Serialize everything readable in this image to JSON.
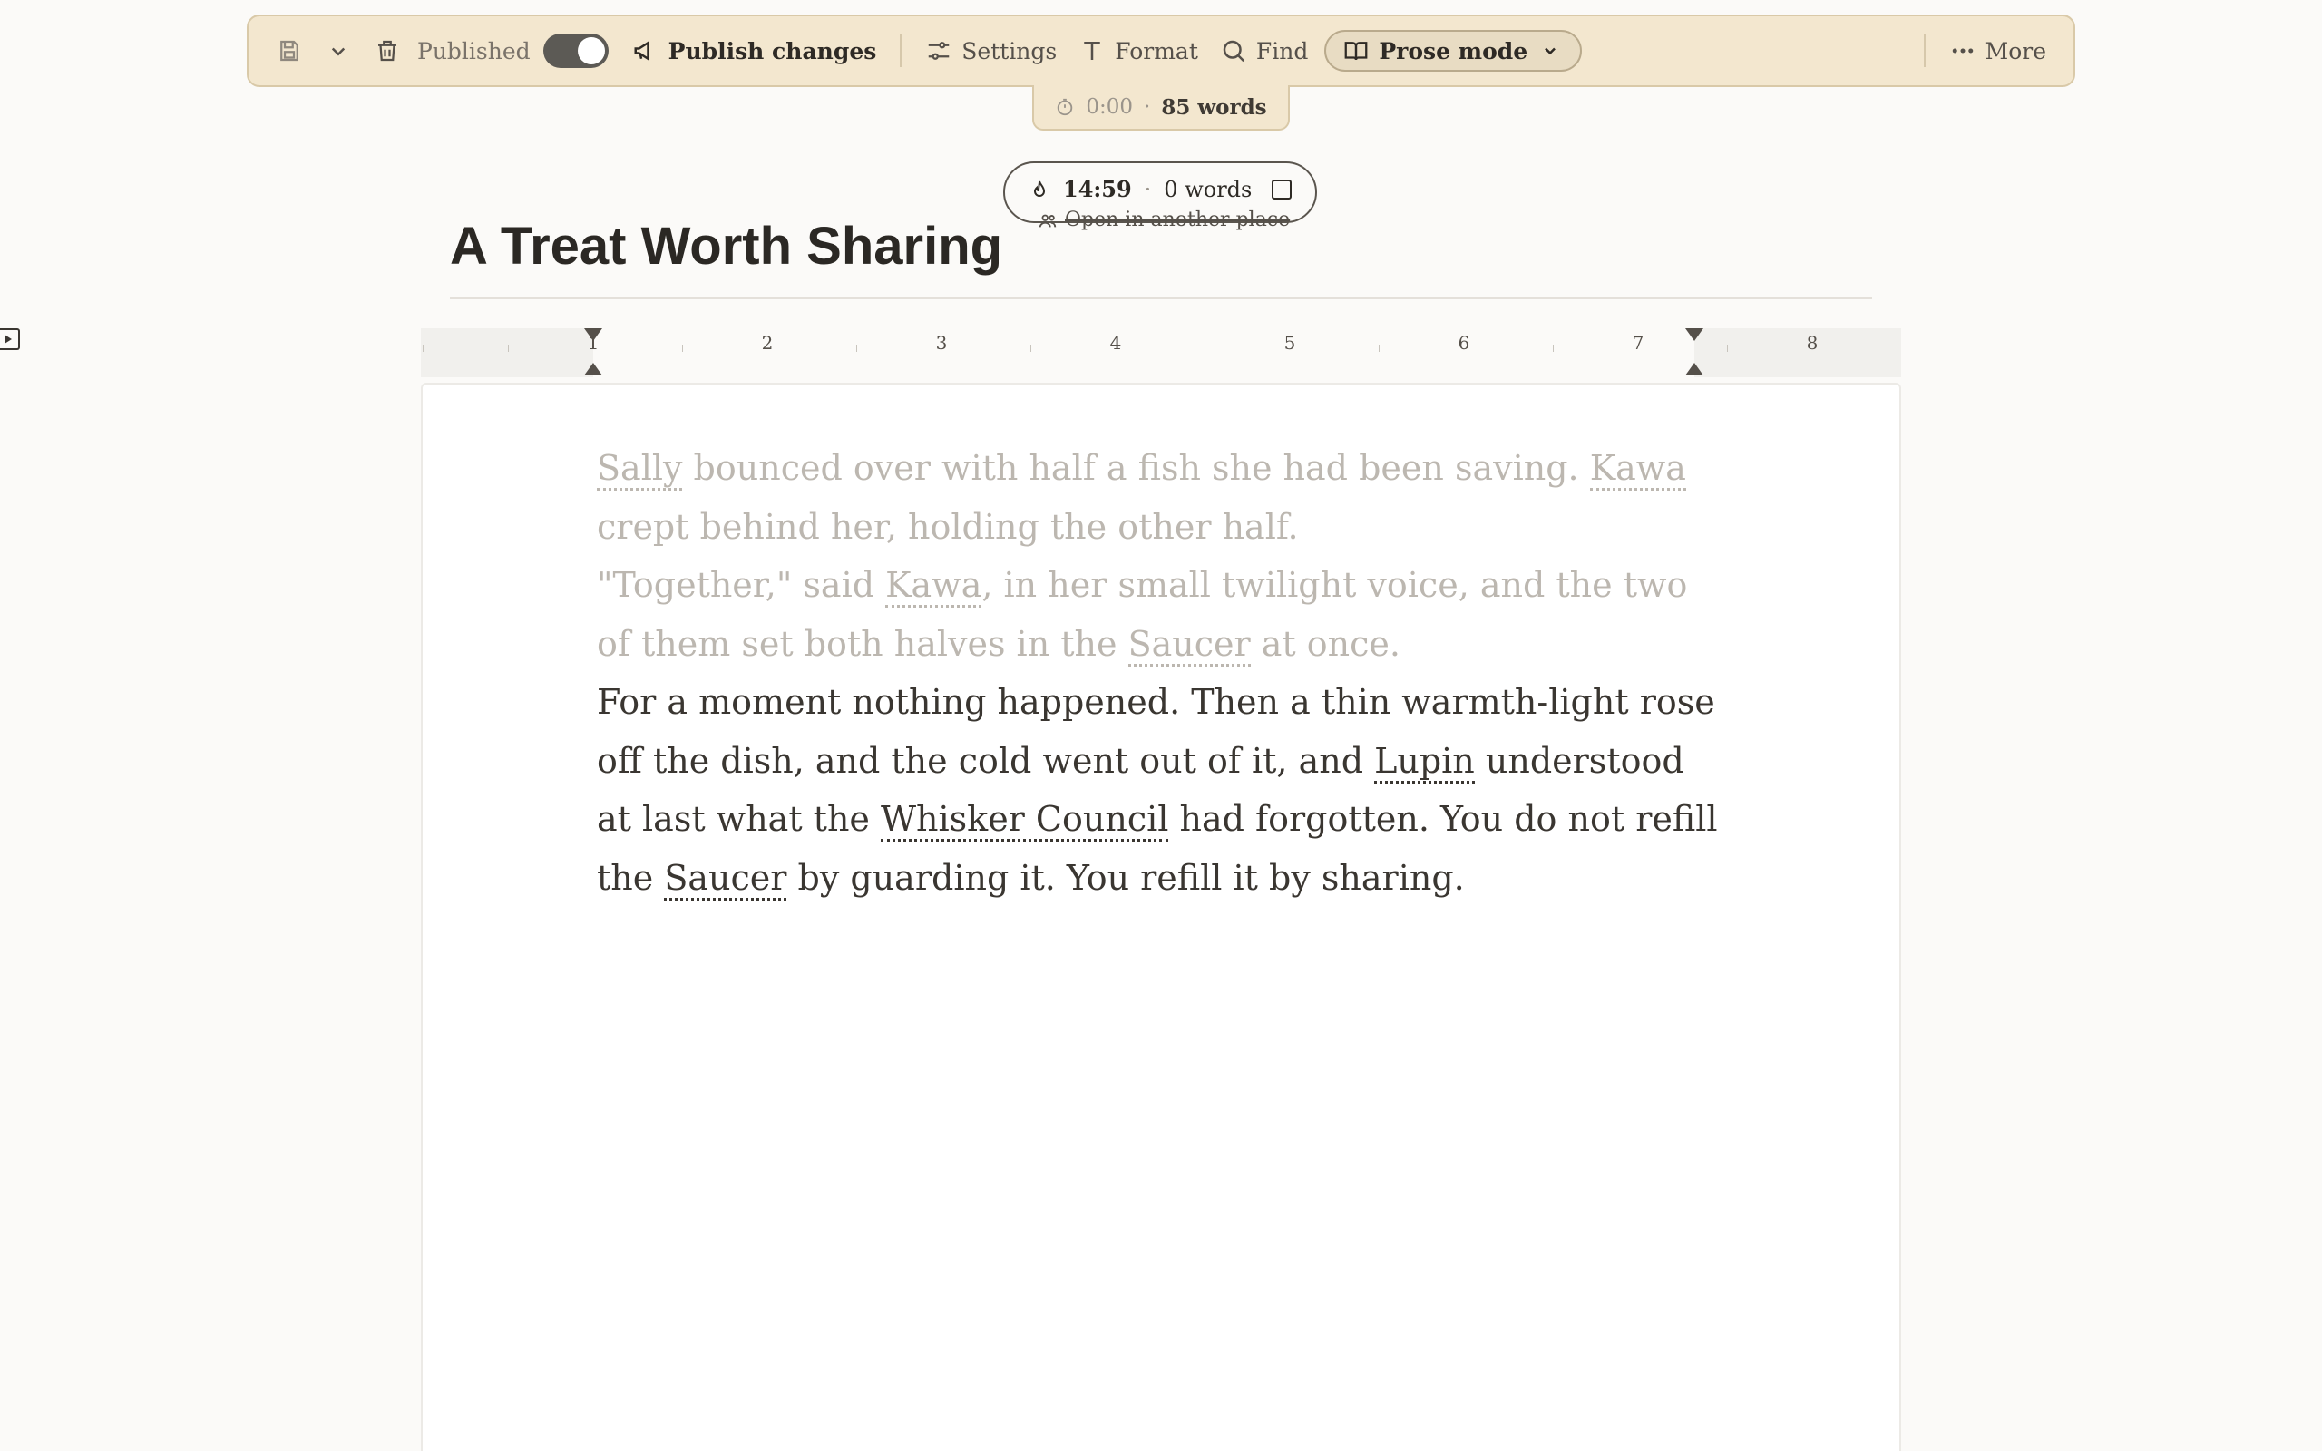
{
  "toolbar": {
    "published_label": "Published",
    "published_on": true,
    "publish_label": "Publish changes",
    "settings_label": "Settings",
    "format_label": "Format",
    "find_label": "Find",
    "prose_mode_label": "Prose mode",
    "more_label": "More"
  },
  "stats": {
    "timer": "0:00",
    "separator": "·",
    "words": "85 words"
  },
  "sprint": {
    "time": "14:59",
    "separator": "·",
    "words": "0 words",
    "open_elsewhere": "Open in another place"
  },
  "document": {
    "title": "A Treat Worth Sharing"
  },
  "ruler": {
    "numbers": [
      "1",
      "2",
      "3",
      "4",
      "5",
      "6",
      "7",
      "8"
    ]
  },
  "prose": {
    "p1": {
      "s1": "Sally",
      "s2": " bounced over with half a fish she had been saving. ",
      "s3": "Kawa",
      "s4": " crept behind her, holding the other half."
    },
    "p2": {
      "s1": "\"Together,\" said ",
      "s2": "Kawa",
      "s3": ", in her small twilight voice, and the two of them set both halves in the ",
      "s4": "Saucer",
      "s5": " at once."
    },
    "p3": {
      "s1": "For a moment nothing happened. Then a thin warmth-light rose off the dish, and the cold went out of it, and ",
      "s2": "Lupin",
      "s3": " understood at last what the ",
      "s4": "Whisker Council",
      "s5": " had forgotten. You do not refill the ",
      "s6": "Saucer",
      "s7": " by guarding it. You refill it by sharing."
    }
  }
}
